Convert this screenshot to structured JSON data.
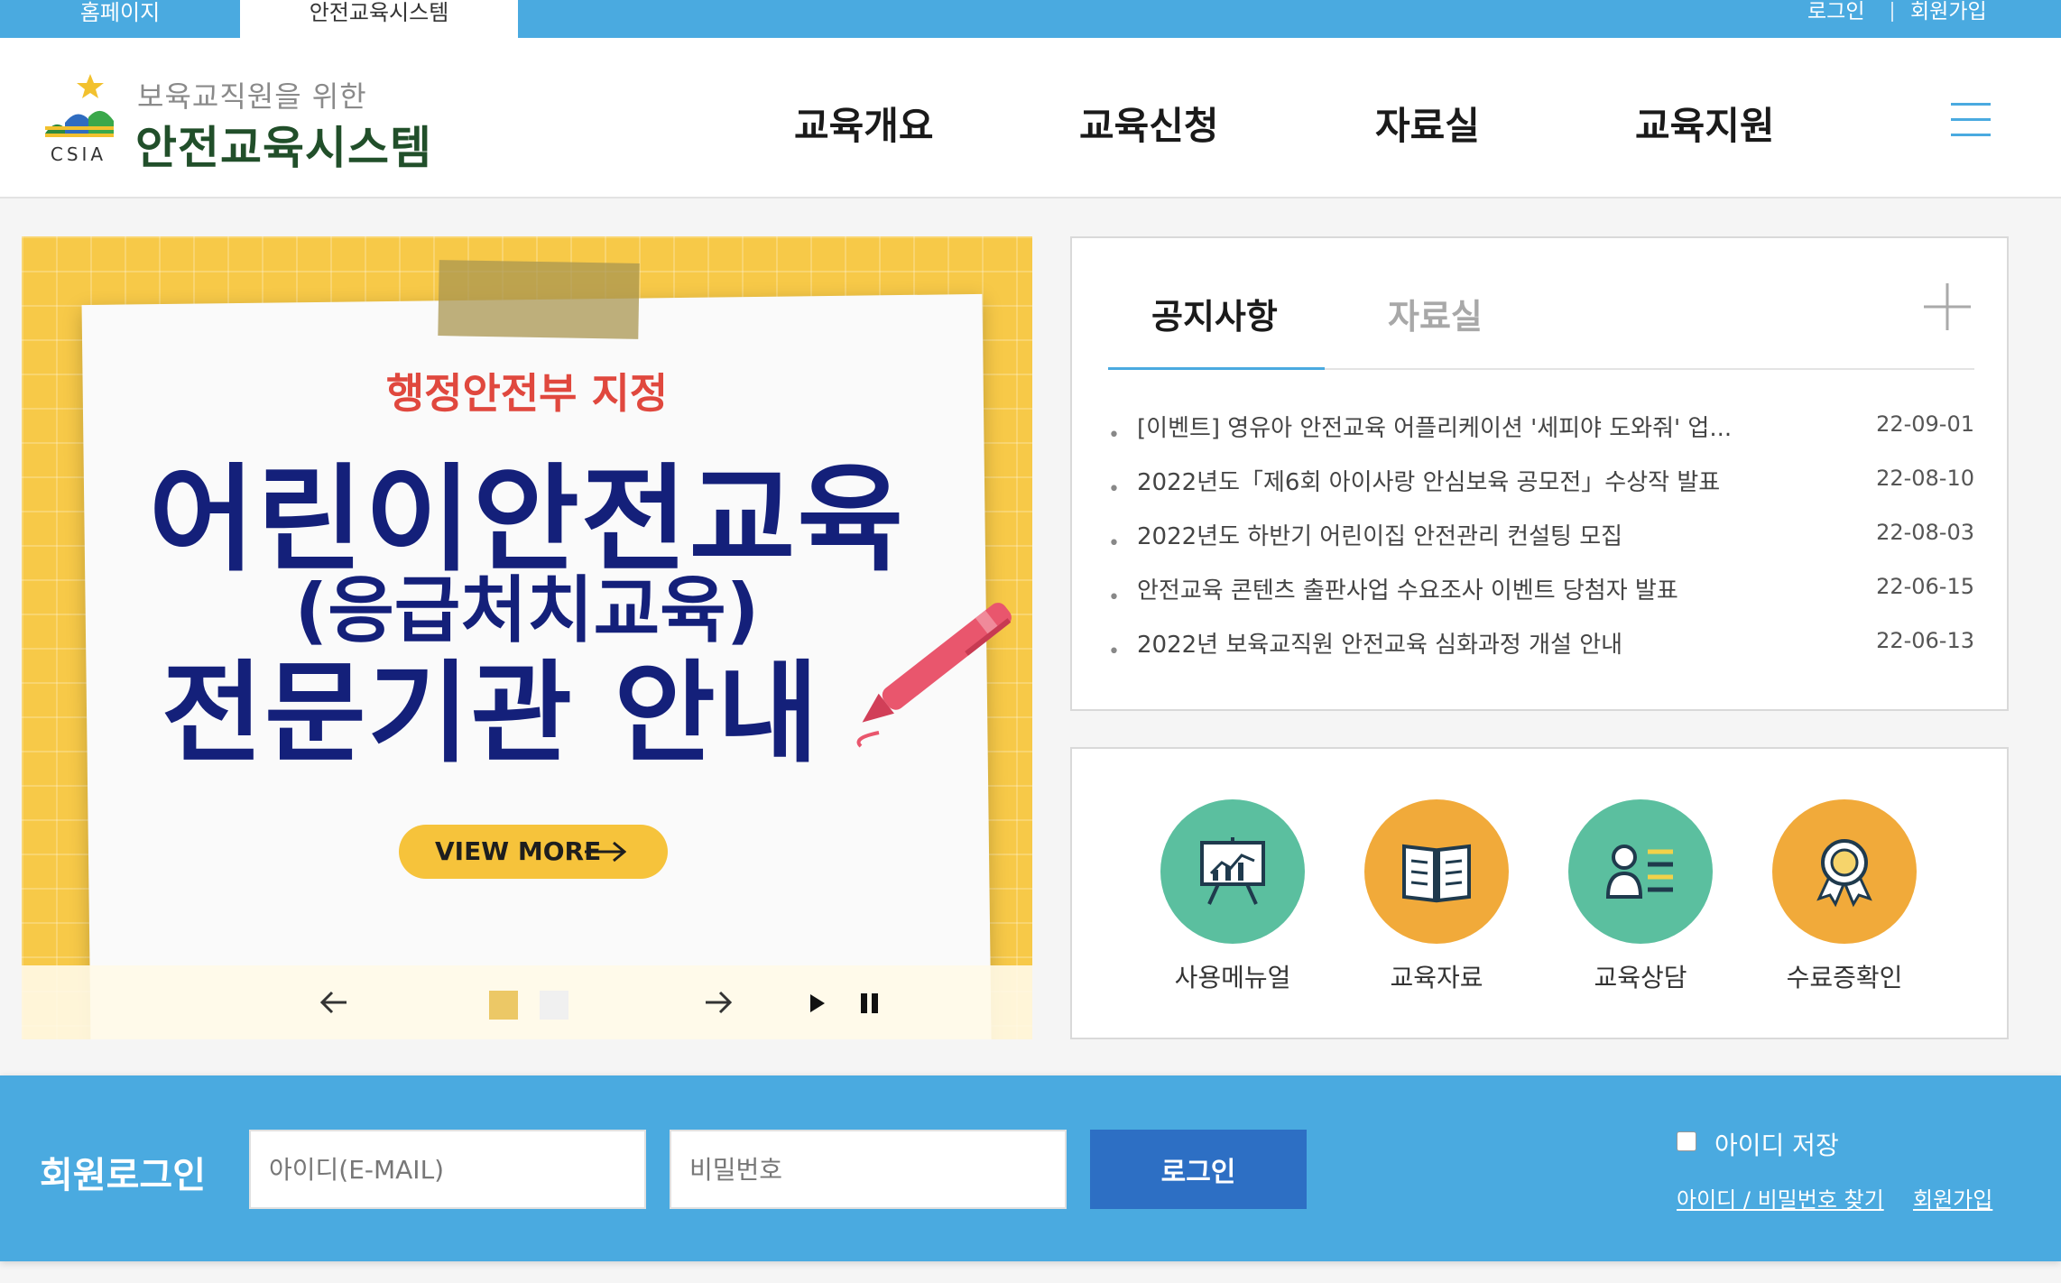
{
  "topbar": {
    "tabs": [
      "홈페이지",
      "안전교육시스템"
    ],
    "login": "로그인",
    "join": "회원가입"
  },
  "header": {
    "logo_sub": "보육교직원을 위한",
    "logo_title": "안전교육시스템",
    "logo_mark_text": "CSIA",
    "nav": [
      "교육개요",
      "교육신청",
      "자료실",
      "교육지원"
    ]
  },
  "banner": {
    "sub": "행정안전부 지정",
    "line1": "어린이안전교육",
    "line2": "(응급처치교육)",
    "line3": "전문기관 안내",
    "button": "VIEW MORE",
    "active_slide": 1,
    "slide_count": 2
  },
  "notice": {
    "tabs": [
      "공지사항",
      "자료실"
    ],
    "items": [
      {
        "title": "[이벤트] 영유아 안전교육 어플리케이션 '세피야 도와줘' 업...",
        "date": "22-09-01"
      },
      {
        "title": "2022년도「제6회 아이사랑 안심보육 공모전」수상작 발표",
        "date": "22-08-10"
      },
      {
        "title": "2022년도 하반기 어린이집 안전관리 컨설팅 모집",
        "date": "22-08-03"
      },
      {
        "title": "안전교육 콘텐츠 출판사업 수요조사 이벤트 당첨자 발표",
        "date": "22-06-15"
      },
      {
        "title": "2022년 보육교직원 안전교육 심화과정 개설 안내",
        "date": "22-06-13"
      }
    ]
  },
  "quick_menu": [
    {
      "label": "사용메뉴얼",
      "icon": "presentation-icon",
      "color": "#5bbf9f"
    },
    {
      "label": "교육자료",
      "icon": "book-icon",
      "color": "#f1aa3a"
    },
    {
      "label": "교육상담",
      "icon": "consult-icon",
      "color": "#5bbf9f"
    },
    {
      "label": "수료증확인",
      "icon": "award-icon",
      "color": "#f1aa3a"
    }
  ],
  "login": {
    "title": "회원로그인",
    "id_placeholder": "아이디(E-MAIL)",
    "pw_placeholder": "비밀번호",
    "button": "로그인",
    "save_id": "아이디 저장",
    "find_link": "아이디 / 비밀번호 찾기",
    "join_link": "회원가입"
  },
  "colors": {
    "primary": "#4aaae0",
    "button": "#2d6fc4",
    "banner_bg": "#f7c948",
    "banner_text": "#14207a",
    "accent_red": "#e0483e"
  }
}
